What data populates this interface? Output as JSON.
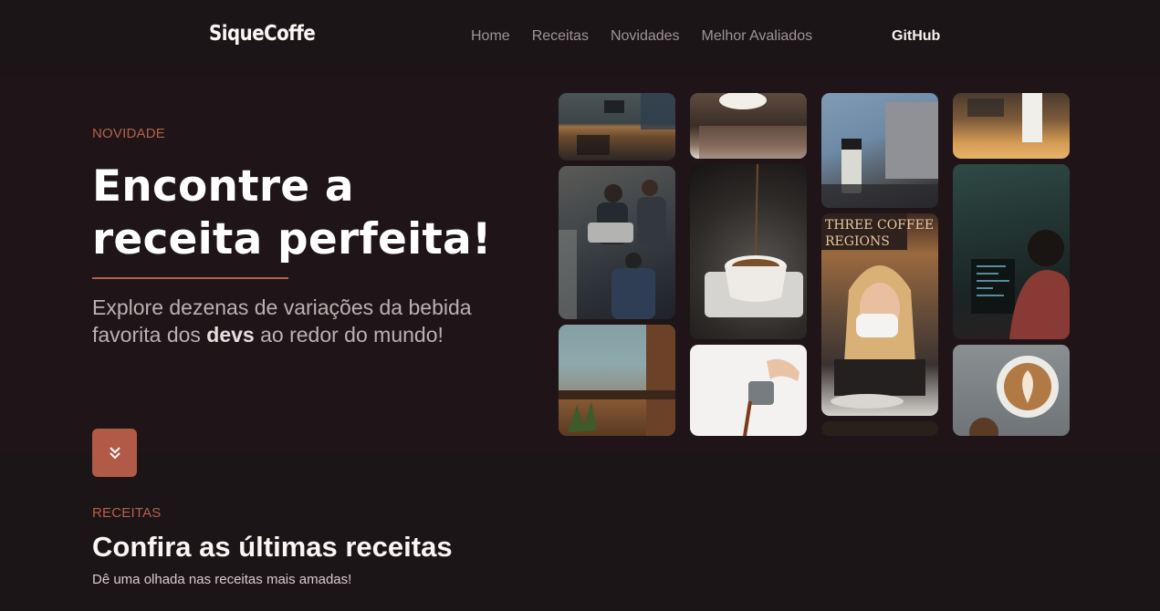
{
  "header": {
    "logo": "SiqueCoffe",
    "nav": [
      "Home",
      "Receitas",
      "Novidades",
      "Melhor Avaliados"
    ],
    "github": "GitHub"
  },
  "hero": {
    "eyebrow": "NOVIDADE",
    "title": "Encontre a receita perfeita!",
    "text_before": "Explore dezenas de variações da bebida favorita dos ",
    "text_bold": "devs",
    "text_after": " ao redor do mundo!",
    "gallery_sign_line1": "THREE COFFEE",
    "gallery_sign_line2": "REGIONS"
  },
  "recipes": {
    "eyebrow": "RECEITAS",
    "title": "Confira as últimas receitas",
    "subtitle": "Dê uma olhada nas receitas mais amadas!"
  },
  "colors": {
    "accent": "#b15a48",
    "background": "#1c1517",
    "hero_background": "#1f1518"
  }
}
